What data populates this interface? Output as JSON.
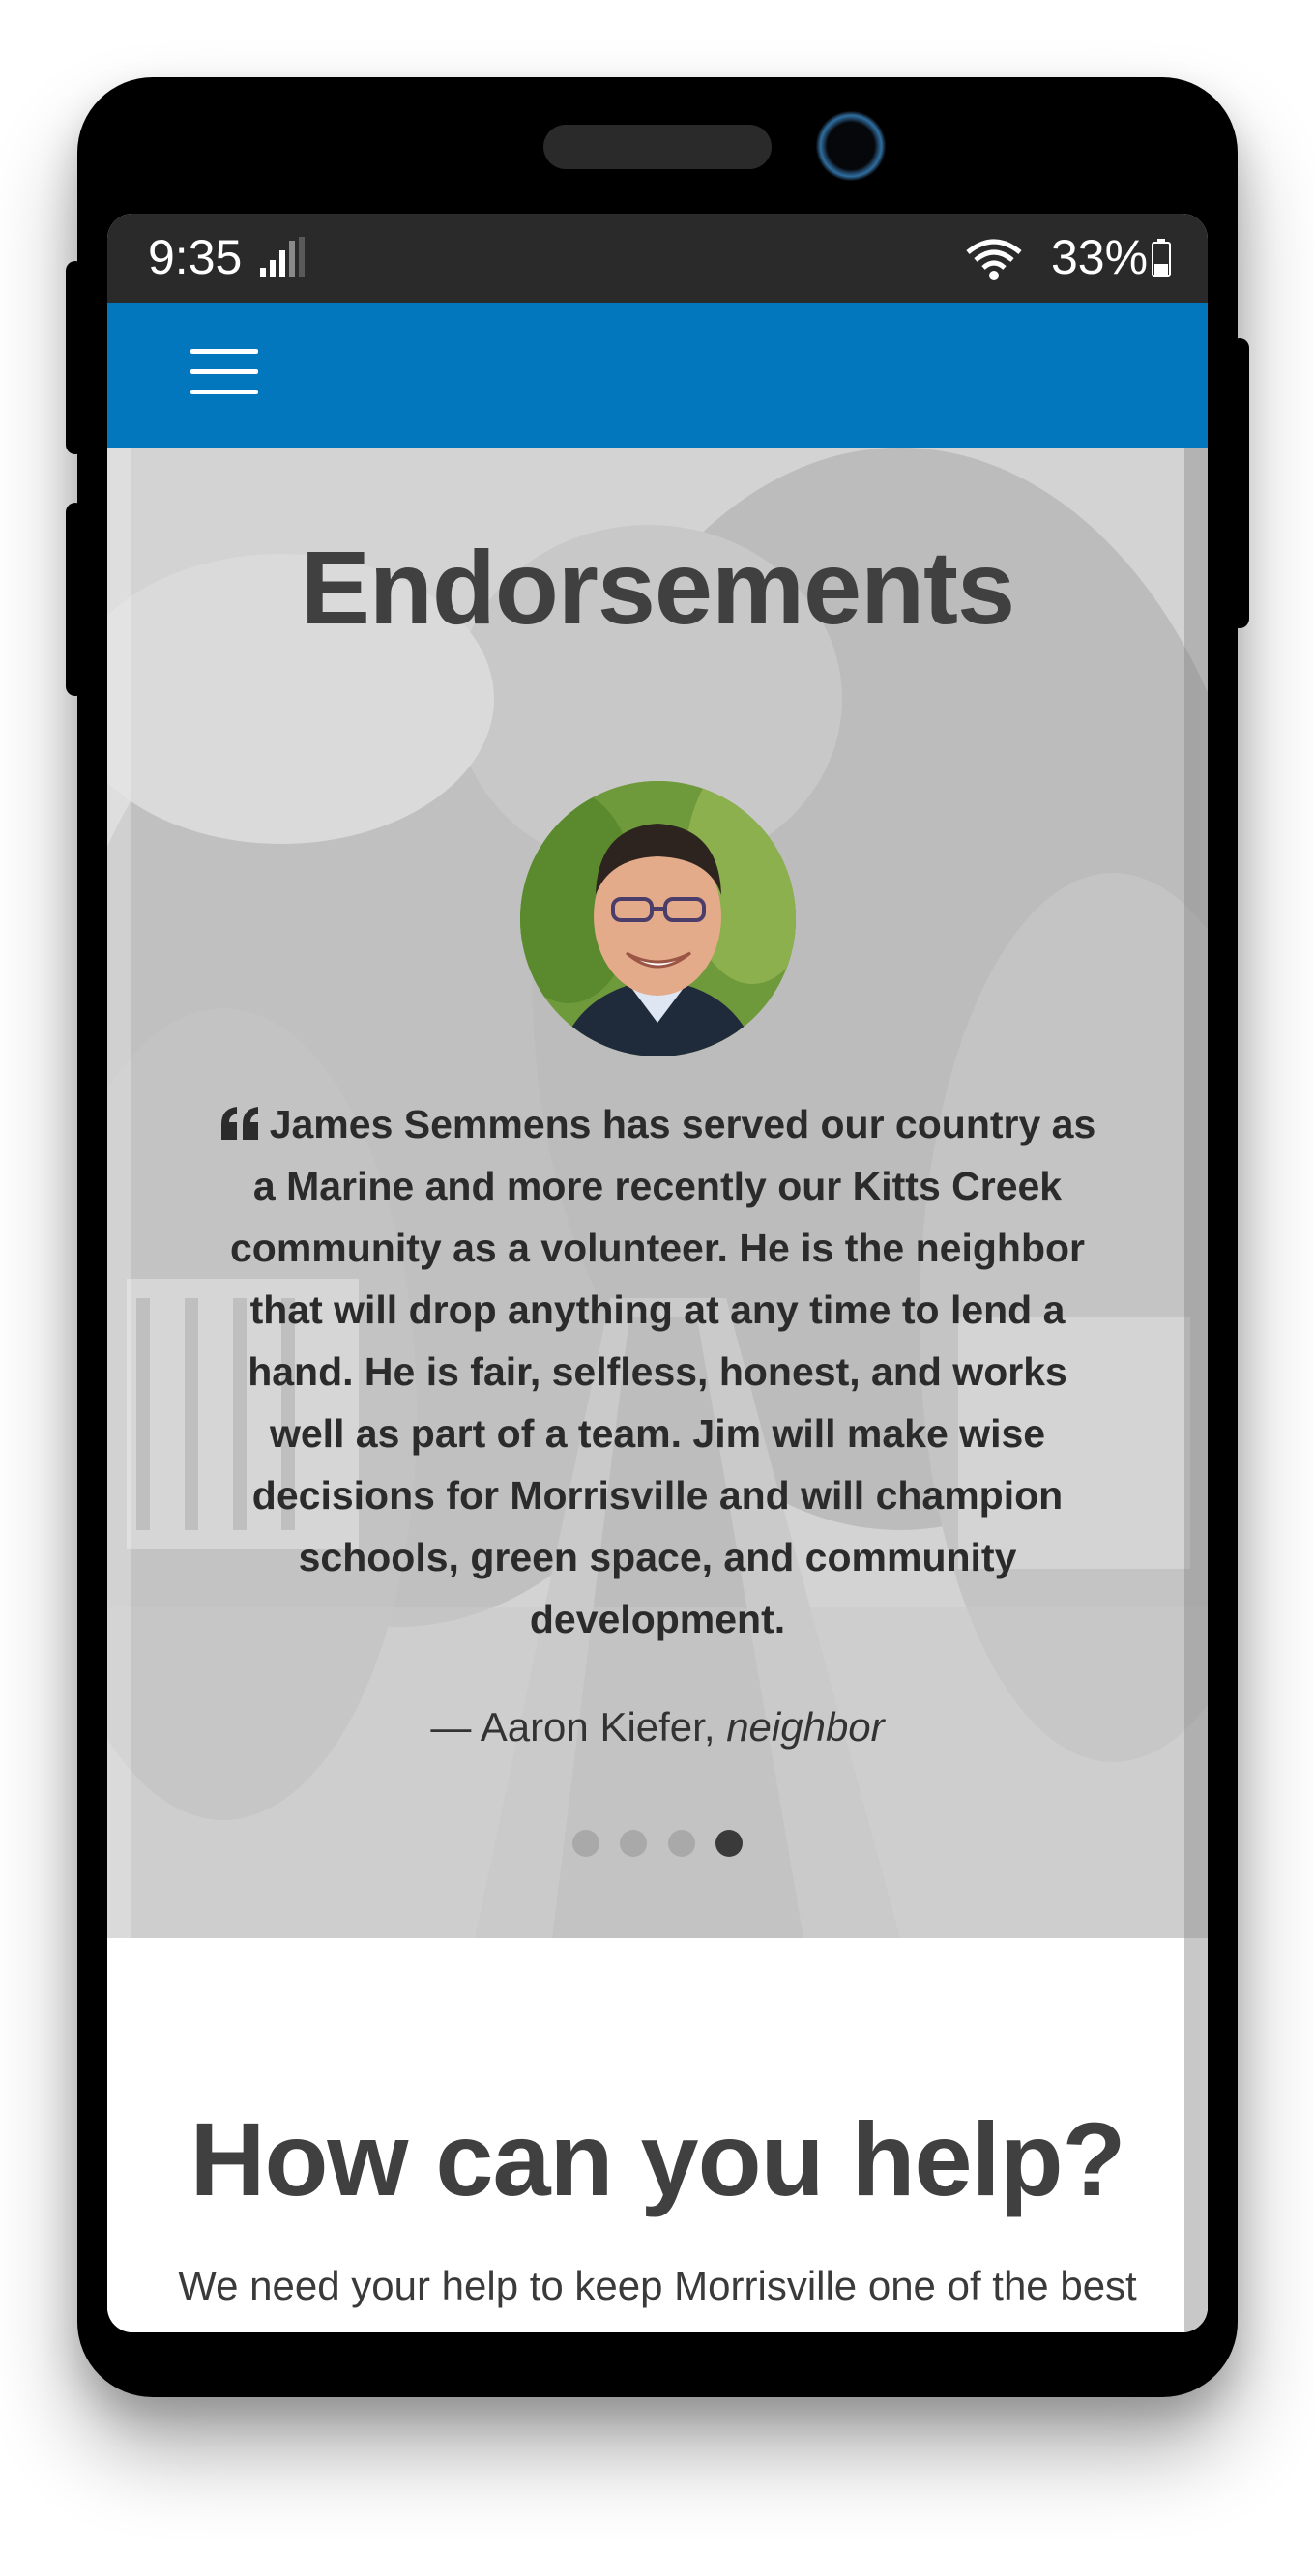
{
  "status_bar": {
    "time": "9:35",
    "battery_percent": "33%",
    "signal_icon": "signal-icon",
    "wifi_icon": "wifi-icon",
    "battery_icon": "battery-icon"
  },
  "navbar": {
    "menu_icon": "hamburger-menu-icon",
    "color": "#0277bd"
  },
  "endorsements": {
    "title": "Endorsements",
    "quote": "James Semmens has served our country as a Marine and more recently our Kitts Creek community as a volunteer. He is the neighbor that will drop anything at any time to lend a hand. He is fair, selfless, honest, and works well as part of a team. Jim will make wise decisions for Morrisville and will champion schools, green space, and community development.",
    "quote_icon": "quote-icon",
    "author_prefix": "— Aaron Kiefer,",
    "author_role": "neighbor",
    "carousel": {
      "total": 4,
      "active": 4
    }
  },
  "help": {
    "title": "How can you help?",
    "text": "We need your help to keep Morrisville one of the best"
  }
}
